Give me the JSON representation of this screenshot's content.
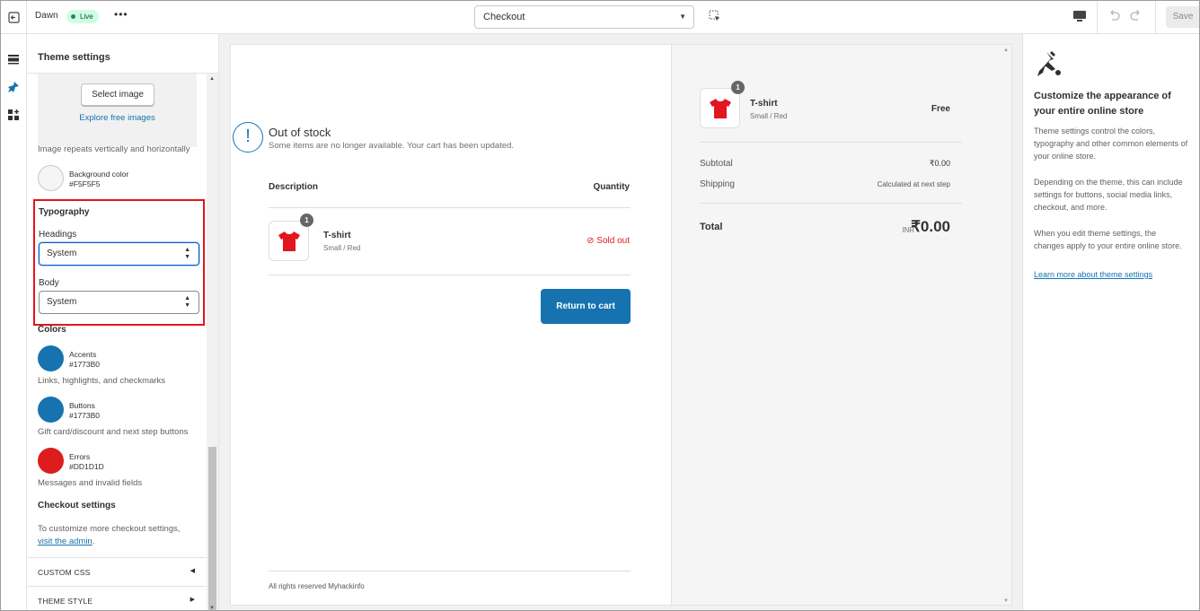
{
  "topbar": {
    "theme_name": "Dawn",
    "live_badge": "Live",
    "more": "•••",
    "page_select": "Checkout",
    "save_label": "Save"
  },
  "sidebar": {
    "title": "Theme settings",
    "select_image": "Select image",
    "explore_images": "Explore free images",
    "image_repeat_note": "Image repeats vertically and horizontally",
    "background": {
      "name": "Background color",
      "hex": "#F5F5F5",
      "color": "#f5f5f5"
    },
    "typography": {
      "title": "Typography",
      "headings_label": "Headings",
      "headings_value": "System",
      "body_label": "Body",
      "body_value": "System"
    },
    "colors": {
      "title": "Colors",
      "accents": {
        "name": "Accents",
        "hex": "#1773B0",
        "color": "#1773b0",
        "desc": "Links, highlights, and checkmarks"
      },
      "buttons": {
        "name": "Buttons",
        "hex": "#1773B0",
        "color": "#1773b0",
        "desc": "Gift card/discount and next step buttons"
      },
      "errors": {
        "name": "Errors",
        "hex": "#DD1D1D",
        "color": "#dd1d1d",
        "desc": "Messages and invalid fields"
      }
    },
    "checkout_settings": {
      "title": "Checkout settings",
      "text": "To customize more checkout settings,",
      "link": "visit the admin",
      "period": "."
    },
    "custom_css": "CUSTOM CSS",
    "theme_style": "THEME STYLE"
  },
  "preview": {
    "oos_title": "Out of stock",
    "oos_subtitle": "Some items are no longer available. Your cart has been updated.",
    "col_description": "Description",
    "col_quantity": "Quantity",
    "item": {
      "name": "T-shirt",
      "variant": "Small / Red",
      "qty": "1",
      "status": "Sold out"
    },
    "return_button": "Return to cart",
    "footer": "All rights reserved Myhackinfo",
    "summary": {
      "item_name": "T-shirt",
      "item_variant": "Small / Red",
      "item_qty": "1",
      "item_price": "Free",
      "subtotal_label": "Subtotal",
      "subtotal_value": "₹0.00",
      "shipping_label": "Shipping",
      "shipping_value": "Calculated at next step",
      "total_label": "Total",
      "currency": "INR",
      "total_value": "₹0.00"
    }
  },
  "info": {
    "title": "Customize the appearance of your entire online store",
    "p1": "Theme settings control the colors, typography and other common elements of your online store.",
    "p2": "Depending on the theme, this can include settings for buttons, social media links, checkout, and more.",
    "p3": "When you edit theme settings, the changes apply to your entire online store.",
    "link": "Learn more about theme settings"
  },
  "icons": [
    "exit-icon",
    "inspect-icon",
    "desktop-icon",
    "undo-icon",
    "redo-icon",
    "sections-icon",
    "theme-settings-icon",
    "app-blocks-icon",
    "paintbrush-icon",
    "tshirt-icon",
    "info-icon"
  ]
}
